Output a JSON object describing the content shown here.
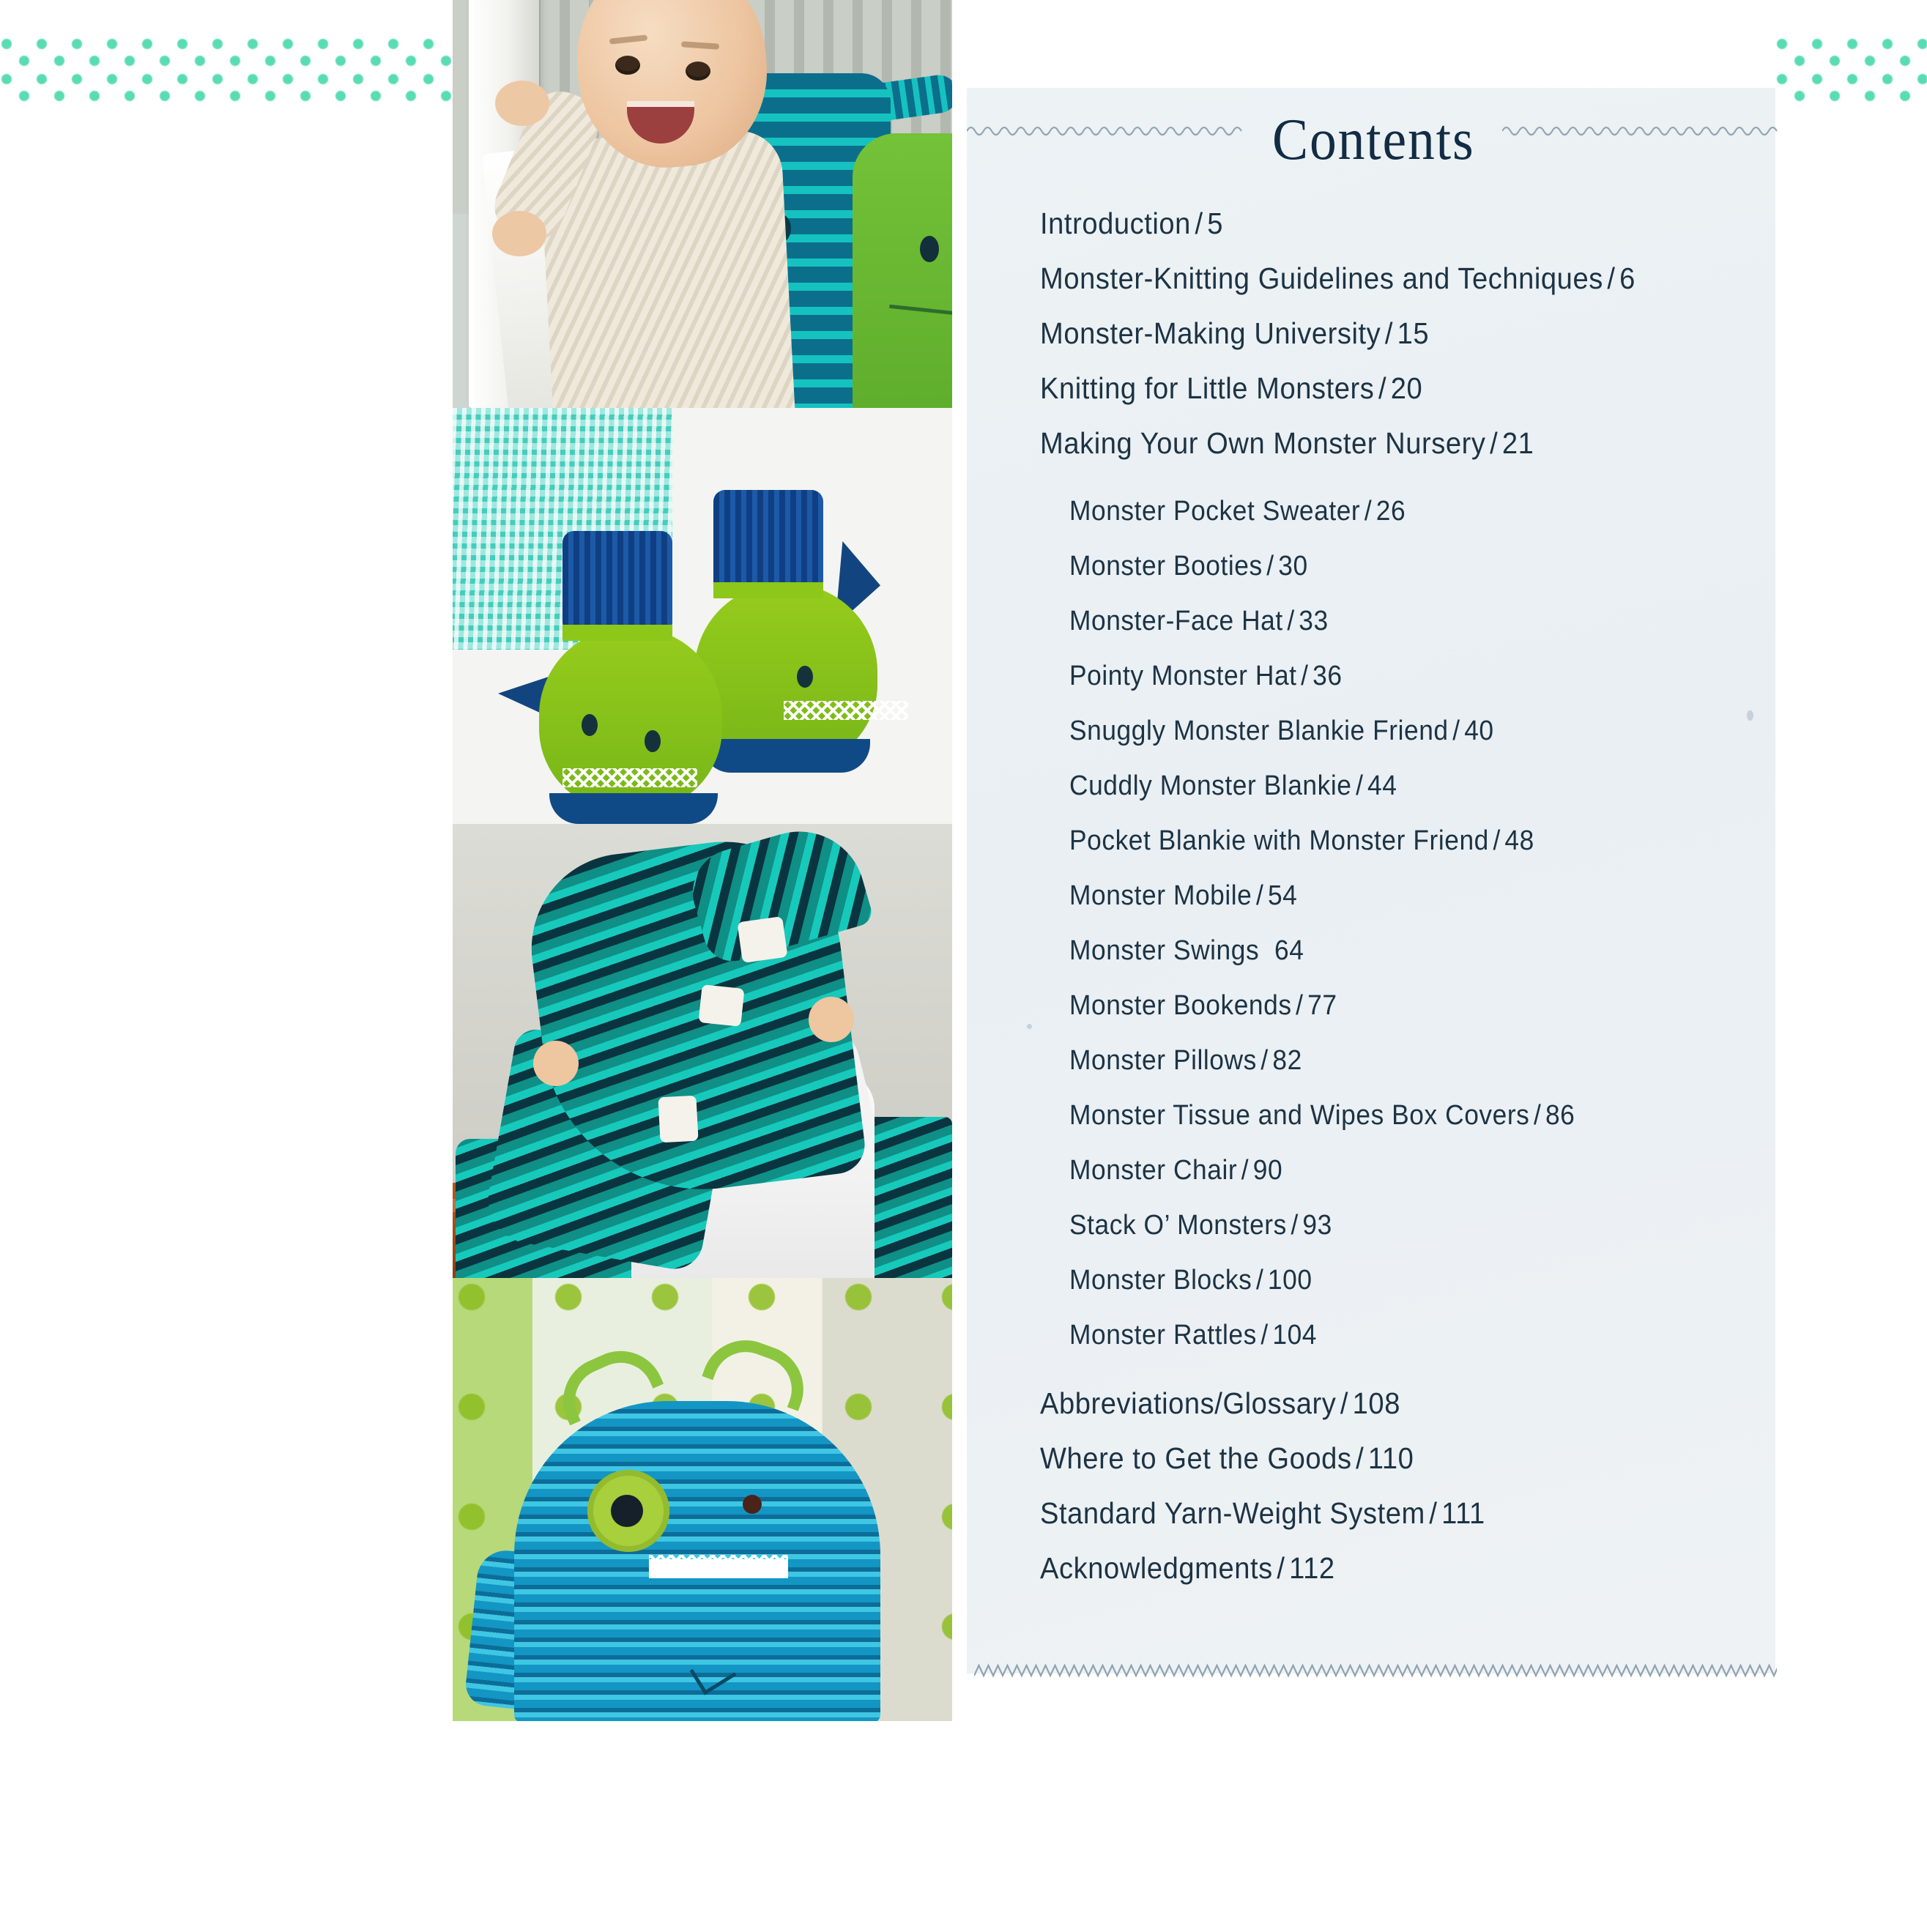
{
  "page": {
    "background": "#ffffff",
    "panel_background": "#eaf0f4",
    "text_color": "#1d3344",
    "dot_color": "#3ed6a6"
  },
  "contents": {
    "title": "Contents",
    "items": [
      {
        "label": "Introduction",
        "sep": "/",
        "page": "5",
        "level": 1
      },
      {
        "label": "Monster-Knitting Guidelines and Techniques",
        "sep": "/",
        "page": "6",
        "level": 1
      },
      {
        "label": "Monster-Making University",
        "sep": "/",
        "page": "15",
        "level": 1
      },
      {
        "label": "Knitting for Little Monsters",
        "sep": "/",
        "page": "20",
        "level": 1
      },
      {
        "label": "Making Your Own Monster Nursery",
        "sep": "/",
        "page": "21",
        "level": 1
      },
      {
        "label": "Monster Pocket Sweater",
        "sep": "/",
        "page": "26",
        "level": 2
      },
      {
        "label": "Monster Booties",
        "sep": "/",
        "page": "30",
        "level": 2
      },
      {
        "label": "Monster-Face Hat",
        "sep": "/",
        "page": "33",
        "level": 2
      },
      {
        "label": "Pointy Monster Hat",
        "sep": "/",
        "page": "36",
        "level": 2
      },
      {
        "label": "Snuggly Monster Blankie Friend",
        "sep": "/",
        "page": "40",
        "level": 2
      },
      {
        "label": "Cuddly Monster Blankie",
        "sep": "/",
        "page": "44",
        "level": 2
      },
      {
        "label": "Pocket Blankie with Monster Friend",
        "sep": "/",
        "page": "48",
        "level": 2
      },
      {
        "label": "Monster Mobile",
        "sep": "/",
        "page": "54",
        "level": 2
      },
      {
        "label": "Monster Swings",
        "sep": "",
        "page": "64",
        "level": 2
      },
      {
        "label": "Monster Bookends",
        "sep": "/",
        "page": "77",
        "level": 2
      },
      {
        "label": "Monster Pillows",
        "sep": "/",
        "page": "82",
        "level": 2
      },
      {
        "label": "Monster Tissue and Wipes Box Covers",
        "sep": "/",
        "page": "86",
        "level": 2
      },
      {
        "label": "Monster Chair",
        "sep": "/",
        "page": "90",
        "level": 2
      },
      {
        "label": "Stack O’ Monsters",
        "sep": "/",
        "page": "93",
        "level": 2
      },
      {
        "label": "Monster Blocks",
        "sep": "/",
        "page": "100",
        "level": 2
      },
      {
        "label": "Monster Rattles",
        "sep": "/",
        "page": "104",
        "level": 2
      },
      {
        "label": "Abbreviations/Glossary",
        "sep": "/",
        "page": "108",
        "level": 1
      },
      {
        "label": "Where to Get the Goods",
        "sep": "/",
        "page": "110",
        "level": 1
      },
      {
        "label": "Standard Yarn-Weight System",
        "sep": "/",
        "page": "111",
        "level": 1
      },
      {
        "label": "Acknowledgments",
        "sep": "/",
        "page": "112",
        "level": 1
      }
    ]
  },
  "photos": [
    {
      "name": "baby-in-crib-photo",
      "caption": "Smiling baby standing in a white crib with knitted blue-striped and green monster toys"
    },
    {
      "name": "monster-booties-photo",
      "caption": "Green knitted monster booties with navy cuffs and fins on a mint blanket"
    },
    {
      "name": "pointy-monster-hat-photo",
      "caption": "Baby wearing a teal striped pointy monster hat with white teeth"
    },
    {
      "name": "monster-pillow-photo",
      "caption": "Blue striped knitted monster pillow with one big green eye and antennae"
    }
  ]
}
